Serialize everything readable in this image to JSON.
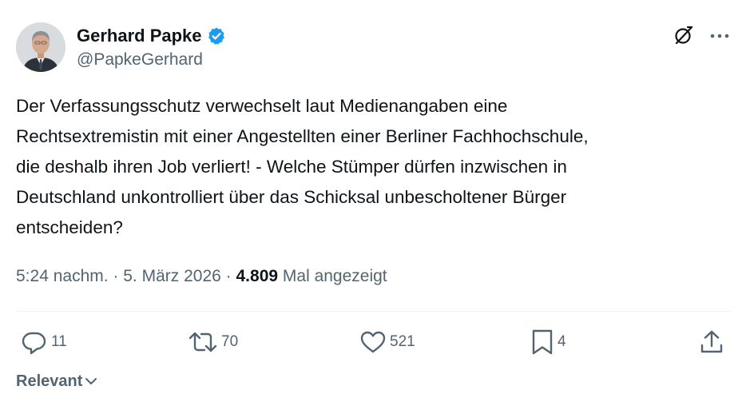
{
  "author": {
    "display_name": "Gerhard Papke",
    "handle": "@PapkeGerhard",
    "verified": true
  },
  "icons": {
    "verified": "verified-badge-icon",
    "grok": "grok-icon",
    "more": "more-icon",
    "reply": "reply-icon",
    "retweet": "retweet-icon",
    "like": "like-icon",
    "bookmark": "bookmark-icon",
    "share": "share-icon",
    "chevron": "chevron-down-icon"
  },
  "tweet": {
    "text": "Der Verfassungsschutz verwechselt laut Medienangaben eine\nRechtsextremistin mit einer Angestellten einer Berliner Fachhochschule,\ndie deshalb ihren Job verliert! - Welche Stümper dürfen inzwischen in\nDeutschland unkontrolliert über das Schicksal unbescholtener Bürger\nentscheiden?",
    "time": "5:24 nachm.",
    "separator": " · ",
    "date": "5. März 2026",
    "views_count": "4.809",
    "views_label": " Mal angezeigt"
  },
  "actions": {
    "replies": "11",
    "retweets": "70",
    "likes": "521",
    "bookmarks": "4"
  },
  "sort": {
    "label": "Relevant"
  },
  "colors": {
    "text": "#0f1419",
    "secondary": "#536471",
    "verified": "#1d9bf0",
    "divider": "#eff3f4"
  }
}
